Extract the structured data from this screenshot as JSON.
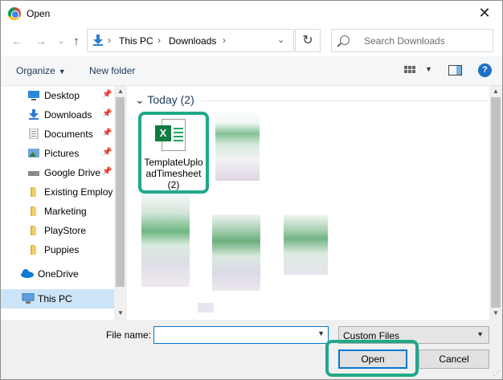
{
  "window": {
    "title": "Open",
    "close_glyph": "✕"
  },
  "nav": {
    "back_glyph": "←",
    "forward_glyph": "→",
    "up_glyph": "↑",
    "address": [
      "This PC",
      "Downloads"
    ],
    "search_placeholder": "Search Downloads"
  },
  "toolbar": {
    "organize": "Organize",
    "new_folder": "New folder",
    "help": "?"
  },
  "sidebar": {
    "items": [
      {
        "label": "Desktop",
        "icon": "desktop-icon",
        "pinned": true
      },
      {
        "label": "Downloads",
        "icon": "download-icon",
        "pinned": true
      },
      {
        "label": "Documents",
        "icon": "documents-icon",
        "pinned": true
      },
      {
        "label": "Pictures",
        "icon": "pictures-icon",
        "pinned": true
      },
      {
        "label": "Google Drive",
        "icon": "drive-icon",
        "pinned": true
      },
      {
        "label": "Existing Employees",
        "icon": "folder-icon",
        "pinned": false
      },
      {
        "label": "Marketing",
        "icon": "folder-icon",
        "pinned": false
      },
      {
        "label": "PlayStore",
        "icon": "folder-icon",
        "pinned": false
      },
      {
        "label": "Puppies",
        "icon": "folder-icon",
        "pinned": false
      },
      {
        "label": "OneDrive",
        "icon": "onedrive-icon",
        "pinned": false
      },
      {
        "label": "This PC",
        "icon": "this-pc-icon",
        "pinned": false
      }
    ]
  },
  "content": {
    "group_header": "Today (2)",
    "file": {
      "name": "TemplateUploadTimesheet (2)",
      "badge": "X"
    }
  },
  "footer": {
    "file_name_label": "File name:",
    "file_name_value": "",
    "file_type": "Custom Files",
    "open_label": "Open",
    "cancel_label": "Cancel"
  },
  "colors": {
    "accent": "#0078d7",
    "highlight_box": "#20a88a",
    "excel_green": "#107c41",
    "selected_bg": "#cce4f7"
  }
}
